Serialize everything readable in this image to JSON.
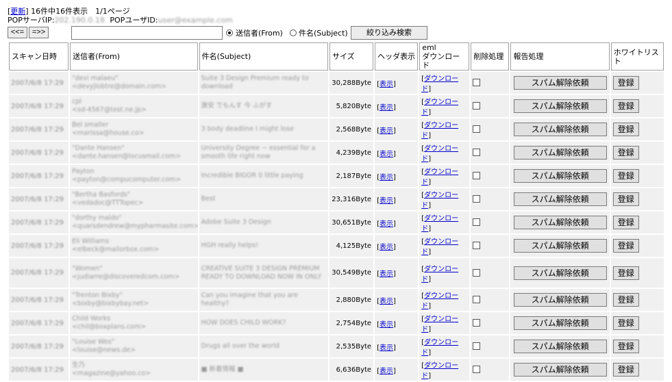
{
  "header": {
    "refresh_label": "更新",
    "count_text": "16件中16件表示　1/1ページ",
    "pop_server_label": "POPサーバIP:",
    "pop_server_value": "202.190.0.18",
    "pop_user_label": "POPユーザID:",
    "pop_user_value": "user@example.com"
  },
  "nav": {
    "prev_label": "<<=",
    "next_label": "=>>"
  },
  "search": {
    "value": "",
    "radio_from_label": "送信者(From)",
    "radio_subject_label": "件名(Subject)",
    "selected": "from",
    "filter_button_label": "絞り込み検索"
  },
  "table": {
    "columns": [
      "スキャン日時",
      "送信者(From)",
      "件名(Subject)",
      "サイズ",
      "ヘッダ表示",
      "eml\nダウンロード",
      "削除処理",
      "報告処理",
      "ホワイトリスト"
    ],
    "view_label": "表示",
    "download_label": "ダウンロード",
    "spam_release_label": "スパム解除依頼",
    "register_label": "登録",
    "rows": [
      {
        "date": "2007/6/8 17:29",
        "from_name": "\"devi malaeu\"",
        "from_addr": "<devyjlobtre@domain.com>",
        "subject": "Suite 3 Design Premium ready to download",
        "size": "30,288Byte"
      },
      {
        "date": "2007/6/8 17:29",
        "from_name": "cpl",
        "from_addr": "<sd-4567@test.ne.jp>",
        "subject": "激安 でもんす 今 ふがす",
        "size": "5,820Byte"
      },
      {
        "date": "2007/6/8 17:29",
        "from_name": "Bel smaller",
        "from_addr": "<marissa@house.co>",
        "subject": "3 body deadline I might lose",
        "size": "2,568Byte"
      },
      {
        "date": "2007/6/8 17:29",
        "from_name": "\"Dante Hansen\"",
        "from_addr": "<dante.hansen@locusmail.com>",
        "subject": "University Degree ~ essential for a smooth life right now",
        "size": "4,239Byte"
      },
      {
        "date": "2007/6/8 17:29",
        "from_name": "Payton",
        "from_addr": "<payton@compucomputer.com>",
        "subject": "Incredible BIGOR 0 little paying",
        "size": "2,187Byte"
      },
      {
        "date": "2007/6/8 17:29",
        "from_name": "\"Bertha Basfords\"",
        "from_addr": "<vedadoc@TTTopec>",
        "subject": "Best",
        "size": "23,316Byte"
      },
      {
        "date": "2007/6/8 17:29",
        "from_name": "\"dorthy maldo\"",
        "from_addr": "<quarsdendrew@mypharmasite.com>",
        "subject": "Adobe Suite 3 Design",
        "size": "30,651Byte"
      },
      {
        "date": "2007/6/8 17:29",
        "from_name": "Eli Williams",
        "from_addr": "<elbeck@mailorbox.com>",
        "subject": "HGH really helps!",
        "size": "4,125Byte"
      },
      {
        "date": "2007/6/8 17:29",
        "from_name": "\"Women\"",
        "from_addr": "<judiarre@discoveredcom.com>",
        "subject": "CREATIVE SUITE 3 DESIGN PREMIUM READY TO DOWNLOAD NOW IN ONLY",
        "size": "30,549Byte",
        "tall": true
      },
      {
        "date": "2007/6/8 17:29",
        "from_name": "\"Trenton Bixby\"",
        "from_addr": "<bixby@bixbybay.net>",
        "subject": "Can you imagine that you are healthy?",
        "size": "2,880Byte"
      },
      {
        "date": "2007/6/8 17:29",
        "from_name": "Child Works",
        "from_addr": "<chil@boxplans.com>",
        "subject": "HOW DOES CHILD WORK?",
        "size": "2,754Byte"
      },
      {
        "date": "2007/6/8 17:29",
        "from_name": "\"Louise Wes\"",
        "from_addr": "<louise@news.de>",
        "subject": "Drugs all over the world",
        "size": "2,535Byte"
      },
      {
        "date": "2007/6/8 17:29",
        "from_name": "生乃",
        "from_addr": "<magazine@yahoo.co>",
        "subject": "■ 新着情報 ■",
        "size": "6,636Byte"
      }
    ]
  }
}
